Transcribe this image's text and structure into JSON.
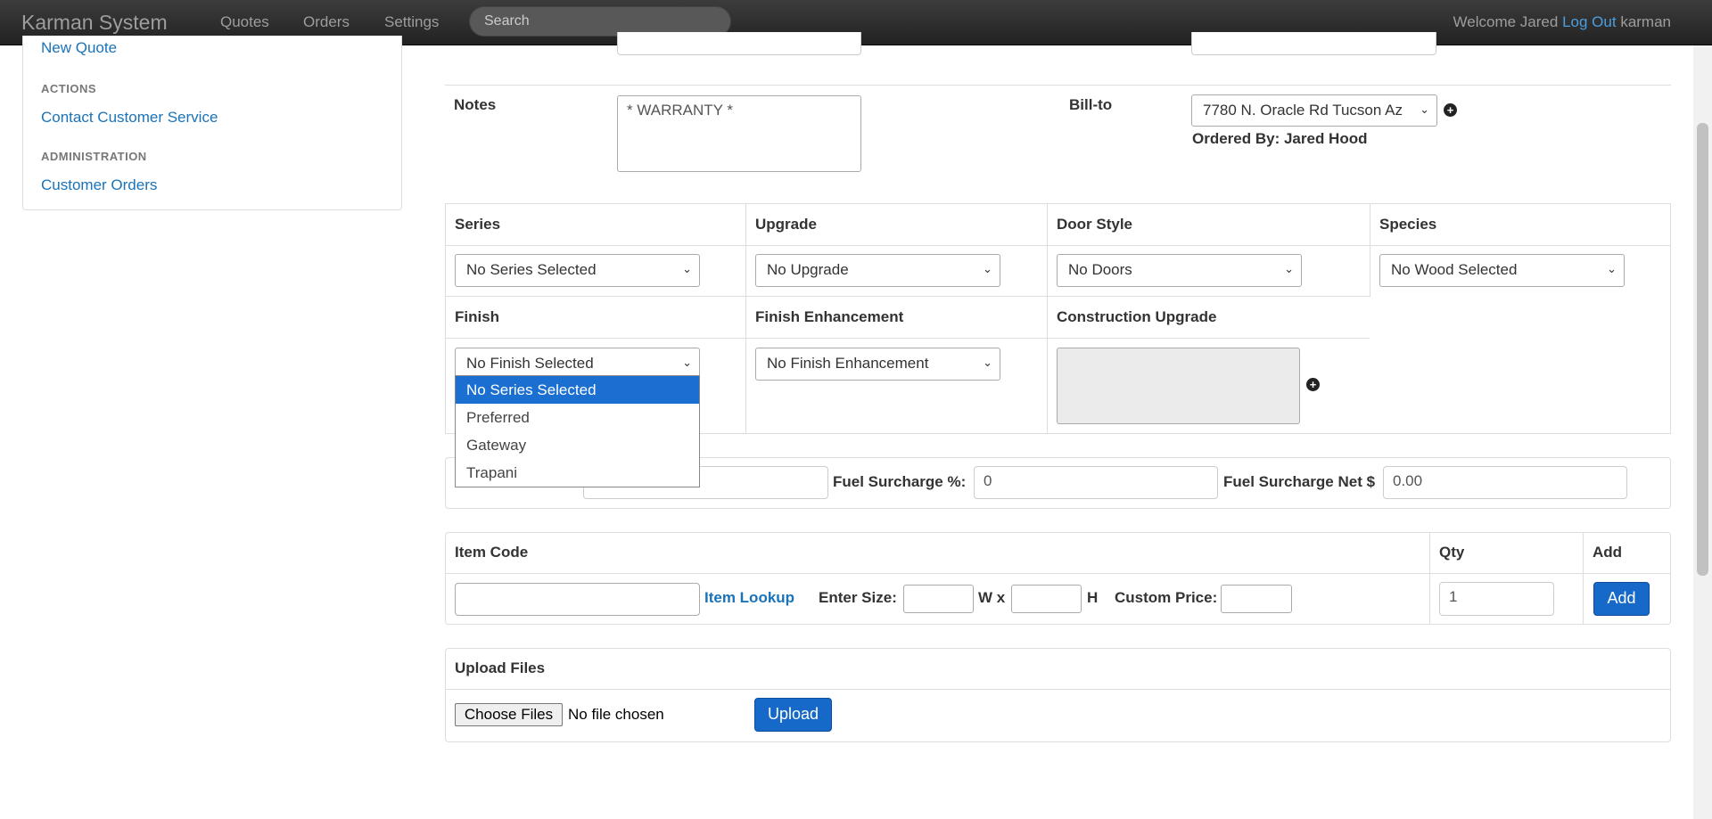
{
  "navbar": {
    "brand": "Karman System",
    "links": [
      "Quotes",
      "Orders",
      "Settings"
    ],
    "search_placeholder": "Search",
    "welcome": "Welcome Jared",
    "logout": "Log Out",
    "username": "karman"
  },
  "sidebar": {
    "new_quote": "New Quote",
    "actions_heading": "ACTIONS",
    "contact": "Contact Customer Service",
    "admin_heading": "ADMINISTRATION",
    "customer_orders": "Customer Orders"
  },
  "order": {
    "notes_label": "Notes",
    "notes_value": "* WARRANTY *",
    "billto_label": "Bill-to",
    "billto_value": "7780 N. Oracle Rd Tucson Az",
    "ordered_by": "Ordered By: Jared Hood"
  },
  "options": {
    "series_label": "Series",
    "series_value": "No Series Selected",
    "upgrade_label": "Upgrade",
    "upgrade_value": "No Upgrade",
    "door_label": "Door Style",
    "door_value": "No Doors",
    "species_label": "Species",
    "species_value": "No Wood Selected",
    "finish_label": "Finish",
    "finish_value": "No Finish Selected",
    "finish_enh_label": "Finish Enhancement",
    "finish_enh_value": "No Finish Enhancement",
    "construction_label": "Construction Upgrade"
  },
  "dropdown": {
    "items": [
      "No Series Selected",
      "Preferred",
      "Gateway",
      "Trapani"
    ],
    "selected_index": 0
  },
  "surcharge": {
    "fuel_pct_label": "Fuel Surcharge %:",
    "fuel_pct_value": "0",
    "fuel_net_label": "Fuel Surcharge Net $",
    "fuel_net_value": "0.00"
  },
  "item": {
    "code_label": "Item Code",
    "qty_label": "Qty",
    "add_label": "Add",
    "lookup": "Item Lookup",
    "size_label": "Enter Size:",
    "w_label": "W x",
    "h_label": "H",
    "custom_price_label": "Custom Price:",
    "qty_value": "1",
    "add_button": "Add"
  },
  "upload": {
    "title": "Upload Files",
    "choose": "Choose Files",
    "no_file": "No file chosen",
    "button": "Upload"
  }
}
